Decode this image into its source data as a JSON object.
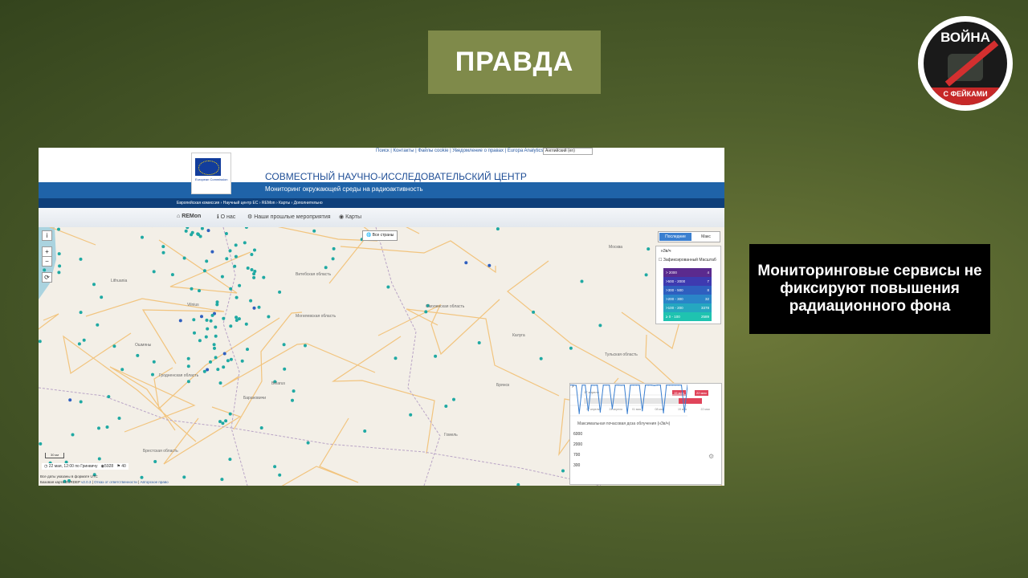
{
  "header": {
    "badge": "ПРАВДА"
  },
  "logo": {
    "top_text": "ВОЙНА",
    "bottom_text": "С ФЕЙКАМИ",
    "colors": {
      "red": "#c62828",
      "dark": "#1a1a1a"
    }
  },
  "caption": {
    "text": "Мониторинговые сервисы не фиксируют повышения радиационного фона"
  },
  "site": {
    "top_links": "Поиск | Контакты | Файлы cookie | Уведомление о правах | Europa Analytics",
    "language": "Английский (en)",
    "eu_label": "European Commission",
    "org_title": "СОВМЕСТНЫЙ НАУЧНО-ИССЛЕДОВАТЕЛЬСКИЙ ЦЕНТР",
    "subtitle": "Мониторинг окружающей среды на радиоактивность",
    "breadcrumbs": "Европейская комиссия › Научный центр ЕС › REMon › Карты › Дополнительно",
    "nav": {
      "home": "REMon",
      "about": "О нас",
      "past": "Наши прошлые мероприятия",
      "maps": "Карты"
    }
  },
  "map": {
    "all_countries": "Все страны",
    "zoom_in": "+",
    "zoom_out": "−",
    "info": "i",
    "tabs": {
      "latest": "Последние",
      "max": "Макс"
    },
    "legend": {
      "unit": "нЗв/ч",
      "fixed_scale_label": "Зафиксированный Масштаб",
      "rows": [
        {
          "range": "> 2000",
          "count": "4",
          "color": "#5b2a8e"
        },
        {
          "range": ">500 - 2000",
          "count": "7",
          "color": "#3e3ab0"
        },
        {
          "range": ">300 - 500",
          "count": "8",
          "color": "#2f5fbf"
        },
        {
          "range": ">200 - 300",
          "count": "32",
          "color": "#2a85c8"
        },
        {
          "range": ">100 - 200",
          "count": "3378",
          "color": "#25a7c0"
        },
        {
          "range": "≥ 0 - 100",
          "count": "2589",
          "color": "#1fc3b0"
        }
      ]
    },
    "labels": [
      "Lithuania",
      "Vilnius",
      "Belarus",
      "Москва",
      "Калуга",
      "Брянск",
      "Гомель",
      "Барановичи",
      "Ошмяны",
      "Смоленская область",
      "Тульская область",
      "Брестская область",
      "Могилевская область",
      "Витебская область",
      "Гродненская область"
    ],
    "scale": "30 км",
    "status": {
      "time": "22 мая, 12:00 по Гринвичу",
      "stations": "5928",
      "flags": "40"
    },
    "utc_note": "Все даты указаны в формате UTC",
    "credits": {
      "base": "Базовая карта EURDEP",
      "version": "v2.0.3",
      "disclaimer": "Отказ от ответственности",
      "copyright": "Авторское право"
    }
  },
  "panel": {
    "start_date": "17 апреля",
    "badge_start": "15 мая",
    "badge_end": "22 мая",
    "ticks": [
      "17 апреля",
      "24 апреля",
      "01 мая",
      "08 мая",
      "15 мая",
      "22 мая"
    ],
    "title": "Максимальная почасовая доза облучения (нЗв/ч)",
    "y_ticks": [
      "6000",
      "2000",
      "700",
      "300"
    ]
  },
  "chart_data": {
    "type": "line",
    "ylabel": "Максимальная почасовая доза облучения (нЗв/ч)",
    "yticks": [
      6000,
      2000,
      700,
      300
    ],
    "scale": "log",
    "series": [
      {
        "values": [
          6000,
          6000,
          5800,
          300,
          6000,
          6000,
          400,
          6000,
          5900,
          6000,
          350,
          6000,
          6000,
          6000,
          500,
          6000,
          6000,
          5900,
          6000,
          300,
          6000,
          6000,
          6000,
          6000,
          400,
          6000,
          6000,
          6000,
          5800,
          6000,
          6000,
          320,
          6000,
          6000,
          6000,
          6000,
          6000,
          6000,
          350,
          6000
        ]
      }
    ]
  }
}
